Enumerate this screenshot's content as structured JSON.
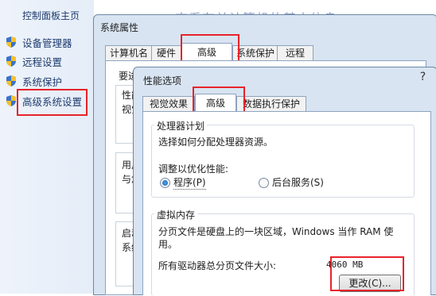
{
  "left_pane": {
    "home_link": "控制面板主页",
    "tasks": [
      {
        "label": "设备管理器",
        "icon": "uac-shield-icon"
      },
      {
        "label": "远程设置",
        "icon": "uac-shield-icon"
      },
      {
        "label": "系统保护",
        "icon": "uac-shield-icon"
      },
      {
        "label": "高级系统设置",
        "icon": "uac-shield-icon"
      }
    ]
  },
  "background_title": "查看有关计算机的基本信息",
  "system_properties": {
    "title": "系统属性",
    "tabs": [
      "计算机名",
      "硬件",
      "高级",
      "系统保护",
      "远程"
    ],
    "active_tab": "高级",
    "notice": "要进",
    "sections": [
      {
        "lines": [
          "性能",
          "视觉"
        ]
      },
      {
        "lines": [
          "用户",
          "与您"
        ]
      },
      {
        "lines": [
          "启动",
          "系统"
        ]
      }
    ]
  },
  "performance_options": {
    "title": "性能选项",
    "help_label": "?",
    "tabs": [
      "视觉效果",
      "高级",
      "数据执行保护"
    ],
    "active_tab": "高级",
    "processor": {
      "heading": "处理器计划",
      "description": "选择如何分配处理器资源。",
      "adjust_label": "调整以优化性能:",
      "options": [
        "程序(P)",
        "后台服务(S)"
      ],
      "selected": "程序(P)"
    },
    "virtual_memory": {
      "heading": "虚拟内存",
      "description": "分页文件是硬盘上的一块区域，Windows 当作 RAM 使用。",
      "description_line1": "分页文件是硬盘上的一块区域，Windows 当作 RAM 使",
      "description_line2": "用。",
      "total_label": "所有驱动器总分页文件大小:",
      "total_value": "4060 MB",
      "change_button": "更改(C)..."
    }
  },
  "highlight_color": "#e8232b"
}
